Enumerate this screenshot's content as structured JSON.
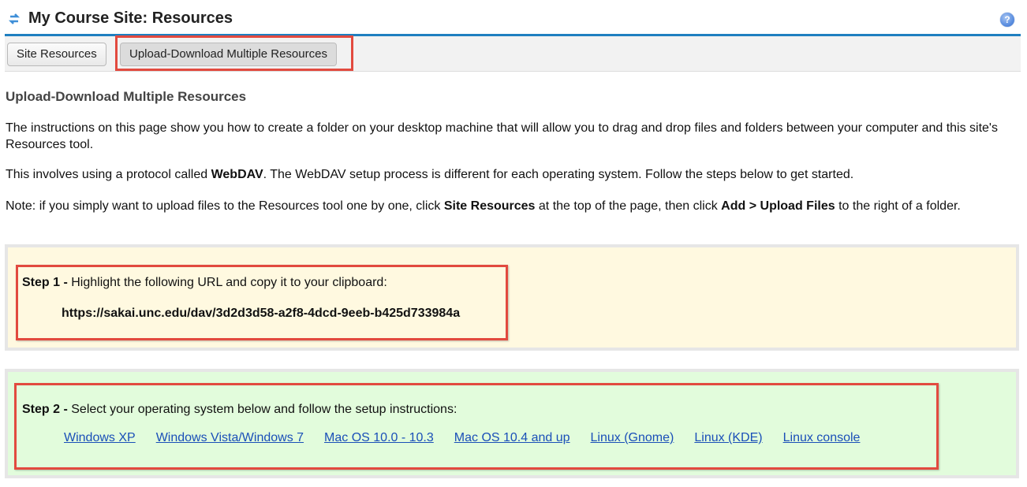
{
  "header": {
    "title": "My Course Site: Resources",
    "help_icon": "question-mark-icon",
    "reset_icon": "reset-arrows-icon"
  },
  "toolbar": {
    "buttons": [
      {
        "label": "Site Resources",
        "active": false
      },
      {
        "label": "Upload-Download Multiple Resources",
        "active": true
      }
    ]
  },
  "main": {
    "section_title": "Upload-Download Multiple Resources",
    "intro": "The instructions on this page show you how to create a folder on your desktop machine that will allow you to drag and drop files and folders between your computer and this site's Resources tool.",
    "webdav_pre": "This involves using a protocol called ",
    "webdav_bold": "WebDAV",
    "webdav_post": ". The WebDAV setup process is different for each operating system. Follow the steps below to get started.",
    "note_pre": "Note: if you simply want to upload files to the Resources tool one by one, click ",
    "note_bold1": "Site Resources",
    "note_mid": " at the top of the page, then click ",
    "note_bold2": "Add > Upload Files",
    "note_post": " to the right of a folder."
  },
  "step1": {
    "label": "Step 1 -",
    "text": " Highlight the following URL and copy it to your clipboard:",
    "url": "https://sakai.unc.edu/dav/3d2d3d58-a2f8-4dcd-9eeb-b425d733984a",
    "background": "#fff9e0"
  },
  "step2": {
    "label": "Step 2 -",
    "text": " Select your operating system below and follow the setup instructions:",
    "background": "#e2fcdc",
    "os_links": [
      "Windows XP",
      "Windows Vista/Windows 7",
      "Mac OS 10.0 - 10.3",
      "Mac OS 10.4 and up",
      "Linux (Gnome)",
      "Linux (KDE)",
      "Linux console"
    ]
  },
  "colors": {
    "accent_line": "#1f7fc0",
    "highlight_box": "#e24a3f",
    "link": "#1a4fb8"
  }
}
